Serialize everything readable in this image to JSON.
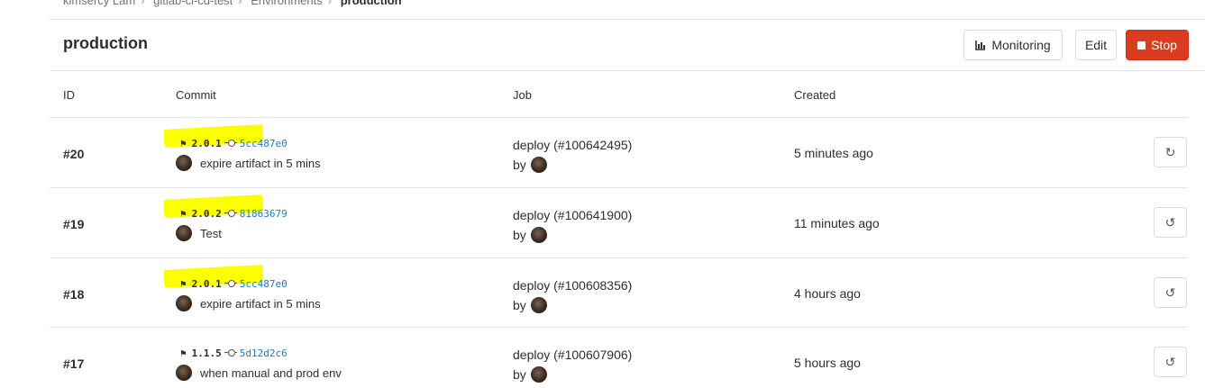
{
  "breadcrumb": [
    "kimsercy Lam",
    "gitlab-ci-cd-test",
    "Environments",
    "production"
  ],
  "page_title": "production",
  "buttons": {
    "monitoring": "Monitoring",
    "edit": "Edit",
    "stop": "Stop"
  },
  "columns": {
    "id": "ID",
    "commit": "Commit",
    "job": "Job",
    "created": "Created"
  },
  "deployments": [
    {
      "id": "#20",
      "tag": "2.0.1",
      "sha": "5cc487e0",
      "message": "expire artifact in 5 mins",
      "job": "deploy (#100642495)",
      "by": "by",
      "created": "5 minutes ago",
      "action_icon": "retry-icon",
      "highlighted": true
    },
    {
      "id": "#19",
      "tag": "2.0.2",
      "sha": "81863679",
      "message": "Test",
      "job": "deploy (#100641900)",
      "by": "by",
      "created": "11 minutes ago",
      "action_icon": "rollback-icon",
      "highlighted": true
    },
    {
      "id": "#18",
      "tag": "2.0.1",
      "sha": "5cc487e0",
      "message": "expire artifact in 5 mins",
      "job": "deploy (#100608356)",
      "by": "by",
      "created": "4 hours ago",
      "action_icon": "rollback-icon",
      "highlighted": true
    },
    {
      "id": "#17",
      "tag": "1.1.5",
      "sha": "5d12d2c6",
      "message": "when manual and prod env",
      "job": "deploy (#100607906)",
      "by": "by",
      "created": "5 hours ago",
      "action_icon": "rollback-icon",
      "highlighted": false
    }
  ],
  "colors": {
    "stop_button": "#db3b21",
    "sha_link": "#1f78d1",
    "highlight": "#fbff00"
  }
}
